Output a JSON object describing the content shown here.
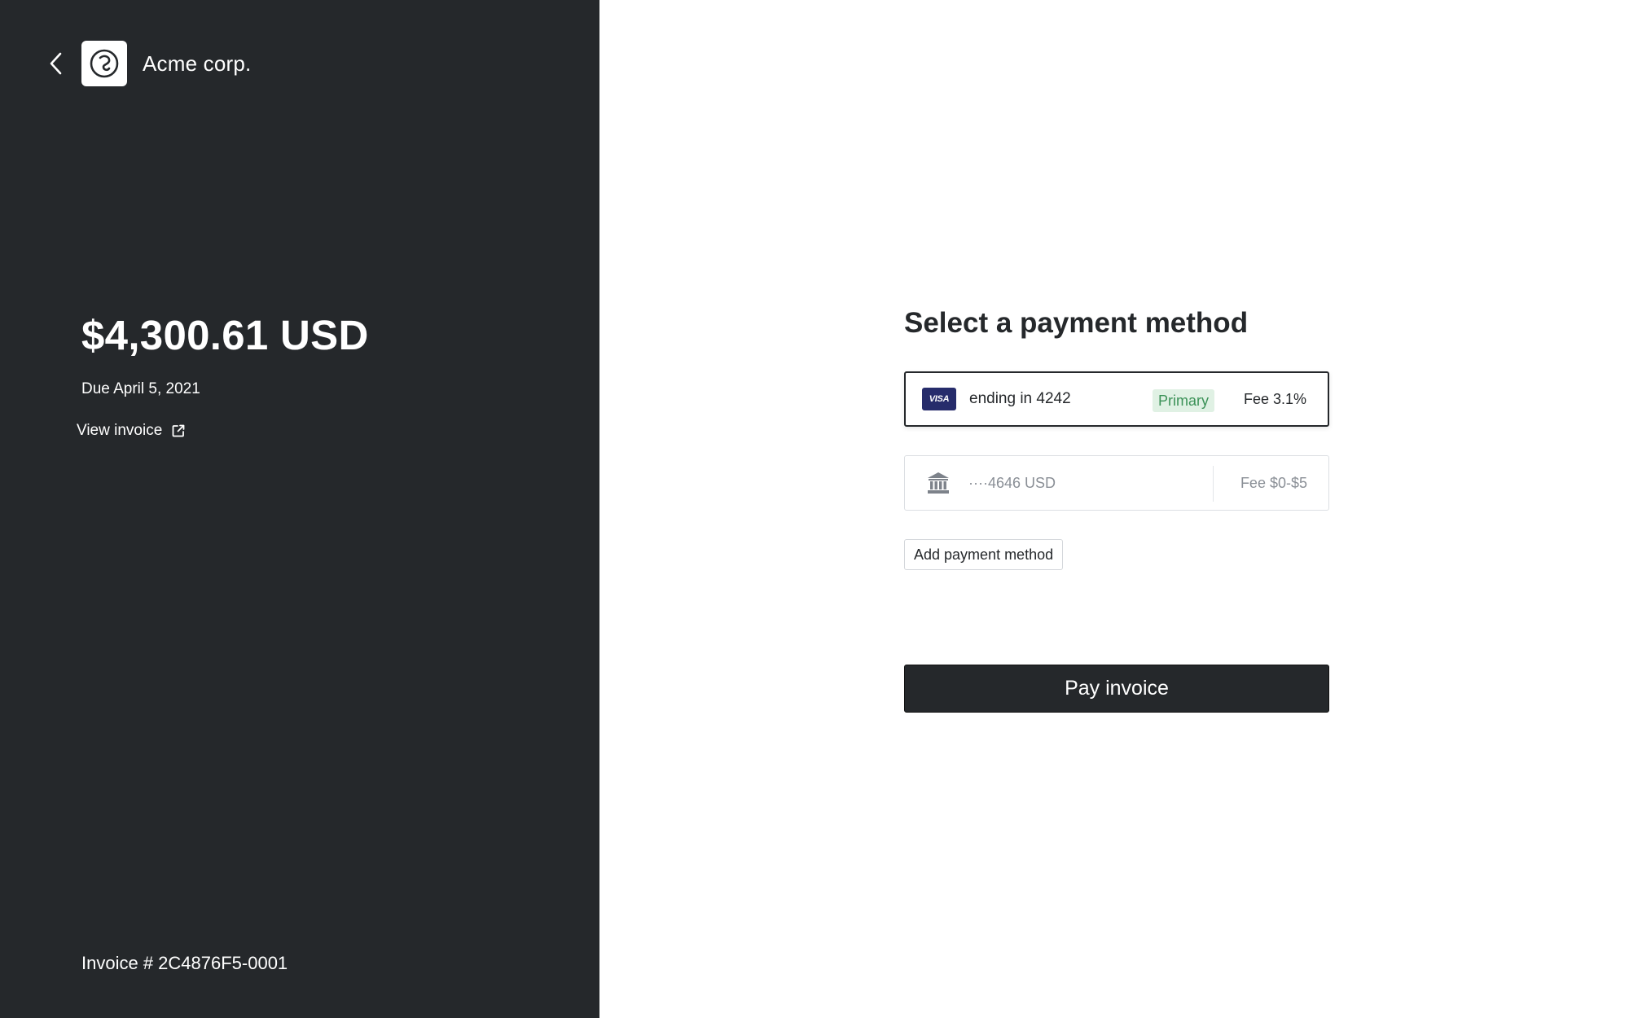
{
  "header": {
    "back_icon": "chevron-left-icon",
    "logo_icon": "company-logo-icon",
    "company_name": "Acme corp."
  },
  "invoice": {
    "amount": "$4,300.61 USD",
    "due": "Due April 5, 2021",
    "view_label": "View invoice",
    "view_icon": "external-link-icon",
    "number": "Invoice # 2C4876F5-0001"
  },
  "payment": {
    "title": "Select a payment method",
    "methods": [
      {
        "brand": "VISA",
        "icon": "visa-card-icon",
        "label": "ending in 4242",
        "badge": "Primary",
        "fee": "Fee 3.1%",
        "selected": true
      },
      {
        "icon": "bank-icon",
        "label": "····4646 USD",
        "fee": "Fee $0-$5",
        "selected": false
      }
    ],
    "add_label": "Add payment method",
    "pay_label": "Pay invoice"
  },
  "colors": {
    "panel_dark": "#25282b",
    "badge_bg": "#e0f1e4",
    "badge_text": "#3c9258",
    "visa_blue": "#262c6b",
    "muted_text": "#8a8f96"
  }
}
